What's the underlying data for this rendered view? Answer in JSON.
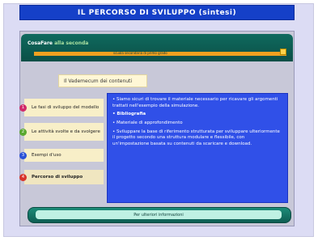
{
  "title": "IL PERCORSO DI SVILUPPO (sintesi)",
  "header": {
    "logo_main": "CosaFare",
    "logo_accent": "alla seconda",
    "sub_text": "scuola secondaria di primo grado"
  },
  "content": {
    "heading": "Il Vademecum dei contenuti",
    "menu": [
      {
        "num": "1",
        "label": "Le fasi di sviluppo del modello",
        "color": "#d12a6a"
      },
      {
        "num": "2",
        "label": "Le attività svolte e da svolgere",
        "color": "#5aa830"
      },
      {
        "num": "3",
        "label": "Esempi d'uso",
        "color": "#2a52d8"
      },
      {
        "num": "4",
        "label": "Percorso di sviluppo",
        "color": "#d8342a"
      }
    ],
    "panel": {
      "p1": "• Siamo sicuri di trovare il materiale necessario per ricavare gli argomenti trattati nell'esempio della simulazione.",
      "p2": "• Bibliografia",
      "p3": "• Materiale di approfondimento",
      "p4": "• Sviluppare la base di riferimento strutturata per sviluppare ulteriormente il progetto secondo una struttura modulare e flessibile, con un'impostazione basata su contenuti da scaricare e download."
    }
  },
  "footer": {
    "label": "Per ulteriori informazioni"
  }
}
